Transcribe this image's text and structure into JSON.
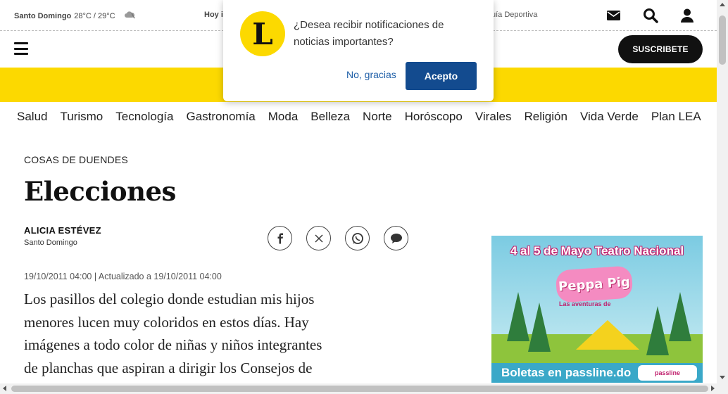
{
  "topbar": {
    "city": "Santo Domingo",
    "temperature": "28°C / 29°C",
    "weather_icon": "cloud-icon",
    "today_label": "Hoy i",
    "guide_label": "uía Deportiva",
    "icons": [
      "mail-icon",
      "search-icon",
      "user-icon"
    ]
  },
  "header": {
    "menu_icon": "hamburger-icon",
    "subscribe_label": "SUSCRIBETE",
    "band_color": "#fcd900"
  },
  "sections": [
    "Salud",
    "Turismo",
    "Tecnología",
    "Gastronomía",
    "Moda",
    "Belleza",
    "Norte",
    "Horóscopo",
    "Virales",
    "Religión",
    "Vida Verde",
    "Plan LEA"
  ],
  "article": {
    "kicker": "COSAS DE DUENDES",
    "title": "Elecciones",
    "author": "ALICIA ESTÉVEZ",
    "location": "Santo Domingo",
    "dateline": "19/10/2011 04:00 | Actualizado a 19/10/2011 04:00",
    "body_lines": [
      "Los pasillos del colegio donde estudian mis hijos",
      "menores lucen muy coloridos en estos días. Hay",
      "imágenes a todo color de niñas y niños integrantes",
      "de planchas que aspiran a dirigir los Consejos de"
    ],
    "share_icons": [
      "facebook-icon",
      "x-icon",
      "whatsapp-icon",
      "comment-icon"
    ]
  },
  "ad": {
    "title": "4 al 5 de Mayo Teatro Nacional",
    "brand": "Peppa Pig",
    "subtitle": "Las aventuras de",
    "cta": "Boletas en passline.do",
    "ticket_brand": "passline"
  },
  "popup": {
    "logo_letter": "L",
    "message": "¿Desea recibir notificaciones de noticias importantes?",
    "decline_label": "No, gracias",
    "accept_label": "Acepto",
    "accept_color": "#134b8f"
  }
}
